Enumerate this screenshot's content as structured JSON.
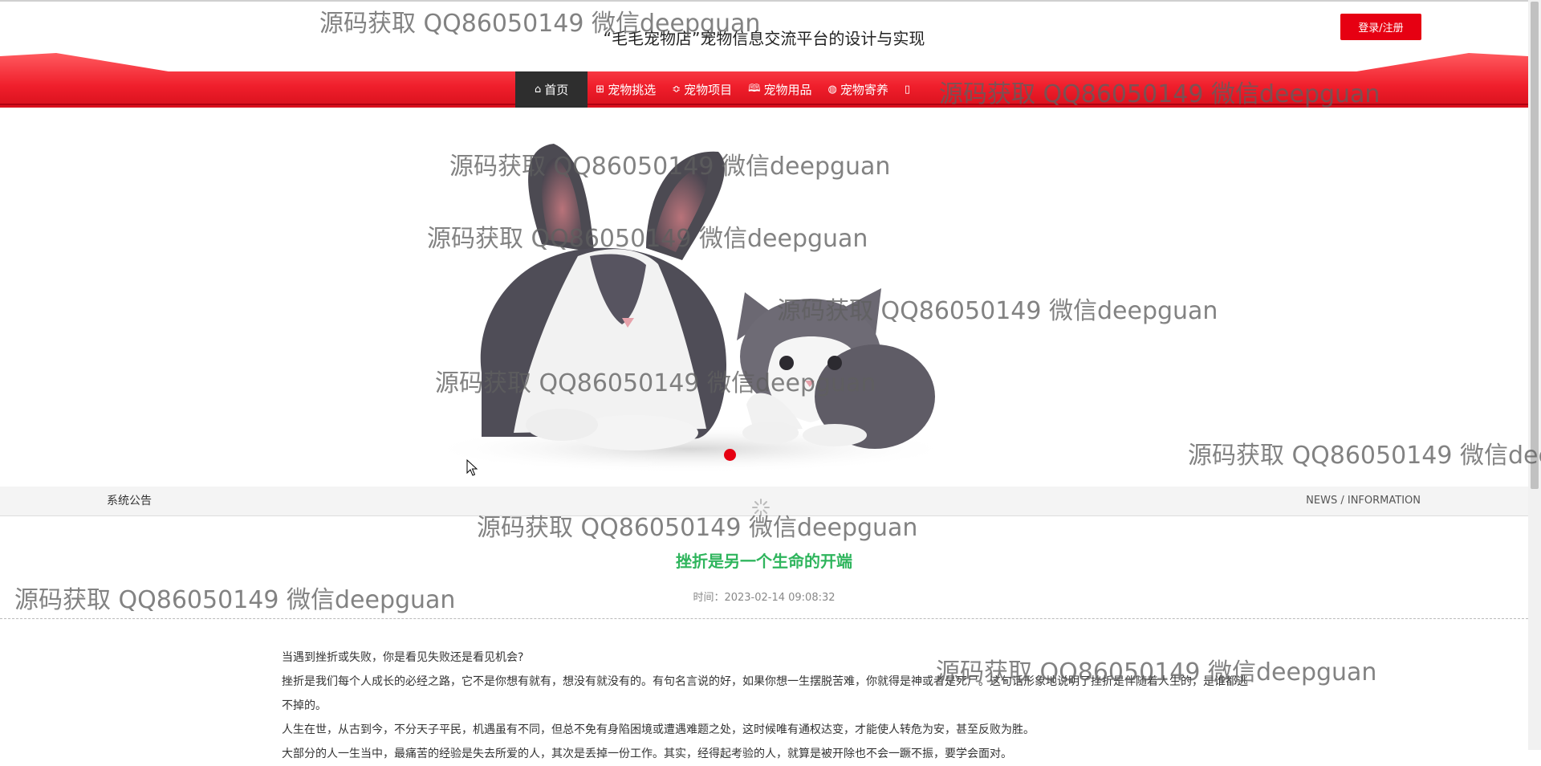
{
  "header": {
    "title": "“毛毛宠物店”宠物信息交流平台的设计与实现",
    "login_label": "登录/注册"
  },
  "nav": {
    "items": [
      {
        "icon": "home-icon",
        "glyph": "⌂",
        "label": "首页",
        "active": true
      },
      {
        "icon": "gift-icon",
        "glyph": "⊞",
        "label": "宠物挑选"
      },
      {
        "icon": "sliders-icon",
        "glyph": "≎",
        "label": "宠物项目"
      },
      {
        "icon": "book-icon",
        "glyph": "🕮",
        "label": "宠物用品"
      },
      {
        "icon": "palette-icon",
        "glyph": "◍",
        "label": "宠物寄养"
      },
      {
        "icon": "doc-icon",
        "glyph": "▯",
        "label": ""
      }
    ],
    "accent_color": "#e60012"
  },
  "banner": {
    "image": "rabbit-and-kitten-photo",
    "active_slide": 1,
    "slide_count": 1
  },
  "notice": {
    "left_label": "系统公告",
    "right_label": "NEWS / INFORMATION"
  },
  "article": {
    "title": "挫折是另一个生命的开端",
    "time": "时间：2023-02-14 09:08:32",
    "paragraphs": [
      "当遇到挫折或失败，你是看见失败还是看见机会?",
      "挫折是我们每个人成长的必经之路，它不是你想有就有，想没有就没有的。有句名言说的好，如果你想一生摆脱苦难，你就得是神或者是死尸。这句话形象地说明了挫折是伴随着人生的，是谁都逃不掉的。",
      "人生在世，从古到今，不分天子平民，机遇虽有不同，但总不免有身陷困境或遭遇难题之处，这时候唯有通权达变，才能使人转危为安，甚至反败为胜。",
      "大部分的人一生当中，最痛苦的经验是失去所爱的人，其次是丢掉一份工作。其实，经得起考验的人，就算是被开除也不会一蹶不振，要学会面对。"
    ]
  },
  "watermark": "源码获取 QQ86050149 微信deepguan"
}
